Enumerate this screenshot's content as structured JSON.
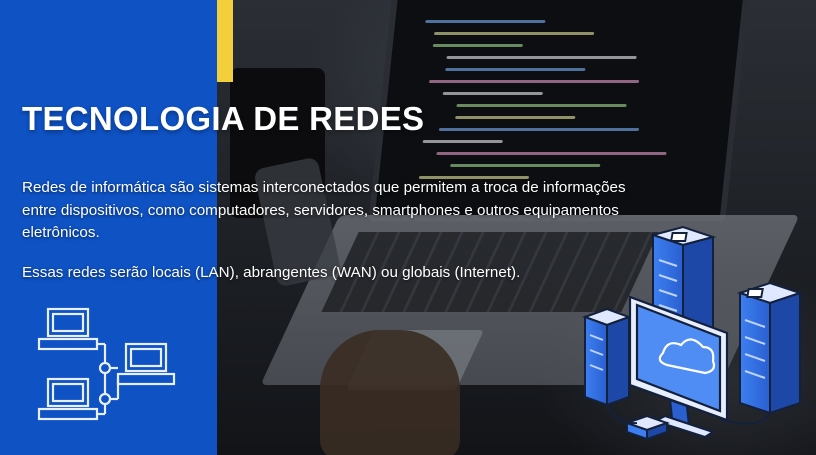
{
  "slide": {
    "title": "TECNOLOGIA DE REDES",
    "paragraphs": [
      "Redes de informática são sistemas interconectados que permitem a troca de informações entre dispositivos, como computadores, servidores, smartphones e outros equipamentos eletrônicos.",
      "Essas redes serão locais (LAN), abrangentes (WAN) ou globais (Internet)."
    ]
  },
  "colors": {
    "panel_blue": "#0e52c4",
    "accent_yellow": "#f4cf3c",
    "text": "#ffffff"
  },
  "icons": [
    "computer-network-icon",
    "server-cloud-illustration"
  ]
}
